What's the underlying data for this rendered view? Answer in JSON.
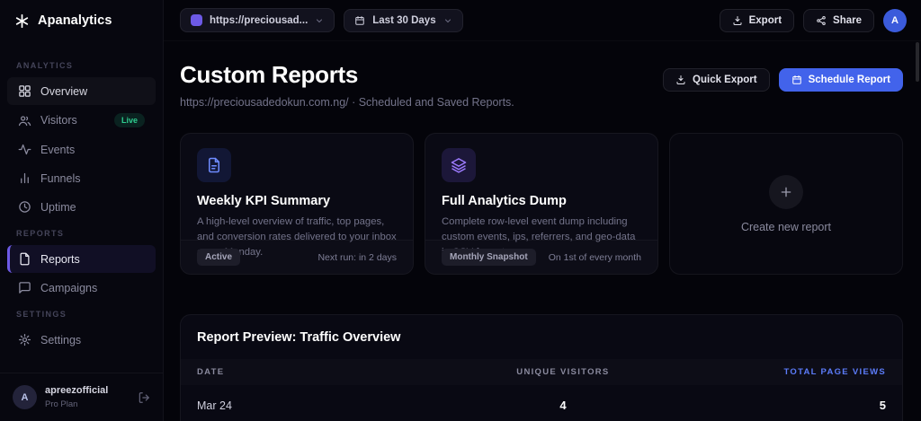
{
  "colors": {
    "accent_blue": "#4263eb",
    "accent_purple": "#6d5ae6",
    "live_green": "#2ecc8f",
    "table_link_blue": "#5c7cfa"
  },
  "sidebar": {
    "logo": "Apanalytics",
    "sections": [
      {
        "title": "ANALYTICS",
        "items": [
          {
            "label": "Overview",
            "icon": "grid-icon"
          },
          {
            "label": "Visitors",
            "icon": "users-icon",
            "badge": "Live"
          },
          {
            "label": "Events",
            "icon": "activity-icon"
          },
          {
            "label": "Funnels",
            "icon": "bar-chart-icon"
          },
          {
            "label": "Uptime",
            "icon": "clock-icon"
          }
        ]
      },
      {
        "title": "REPORTS",
        "items": [
          {
            "label": "Reports",
            "icon": "file-icon",
            "active": true
          },
          {
            "label": "Campaigns",
            "icon": "chat-icon"
          }
        ]
      },
      {
        "title": "SETTINGS",
        "items": [
          {
            "label": "Settings",
            "icon": "gear-icon"
          }
        ]
      }
    ],
    "user": {
      "initial": "A",
      "name": "apreezofficial",
      "plan": "Pro Plan",
      "logout_icon": "logout-icon"
    }
  },
  "topbar": {
    "site_selector": "https://preciousad...",
    "date_range": "Last 30 Days",
    "date_icon": "calendar-icon",
    "export": "Export",
    "export_icon": "download-icon",
    "share": "Share",
    "share_icon": "share-icon",
    "avatar_initial": "A"
  },
  "page": {
    "title": "Custom Reports",
    "subtitle": "https://preciousadedokun.com.ng/ · Scheduled and Saved Reports.",
    "quick_export": "Quick Export",
    "quick_export_icon": "download-icon",
    "schedule_report": "Schedule Report",
    "schedule_report_icon": "calendar-icon"
  },
  "cards": [
    {
      "icon": "file-text-icon",
      "title": "Weekly KPI Summary",
      "description": "A high-level overview of traffic, top pages, and conversion rates delivered to your inbox every Monday.",
      "badge": "Active",
      "meta": "Next run: in 2 days"
    },
    {
      "icon": "layers-icon",
      "title": "Full Analytics Dump",
      "description": "Complete row-level event dump including custom events, ips, referrers, and geo-data in CSV format.",
      "badge": "Monthly Snapshot",
      "meta": "On 1st of every month"
    }
  ],
  "create_card": {
    "label": "Create new report",
    "icon": "plus-icon"
  },
  "preview": {
    "title": "Report Preview: Traffic Overview",
    "columns": [
      "DATE",
      "UNIQUE VISITORS",
      "TOTAL PAGE VIEWS"
    ],
    "rows": [
      [
        "Mar 24",
        "4",
        "5"
      ]
    ]
  }
}
